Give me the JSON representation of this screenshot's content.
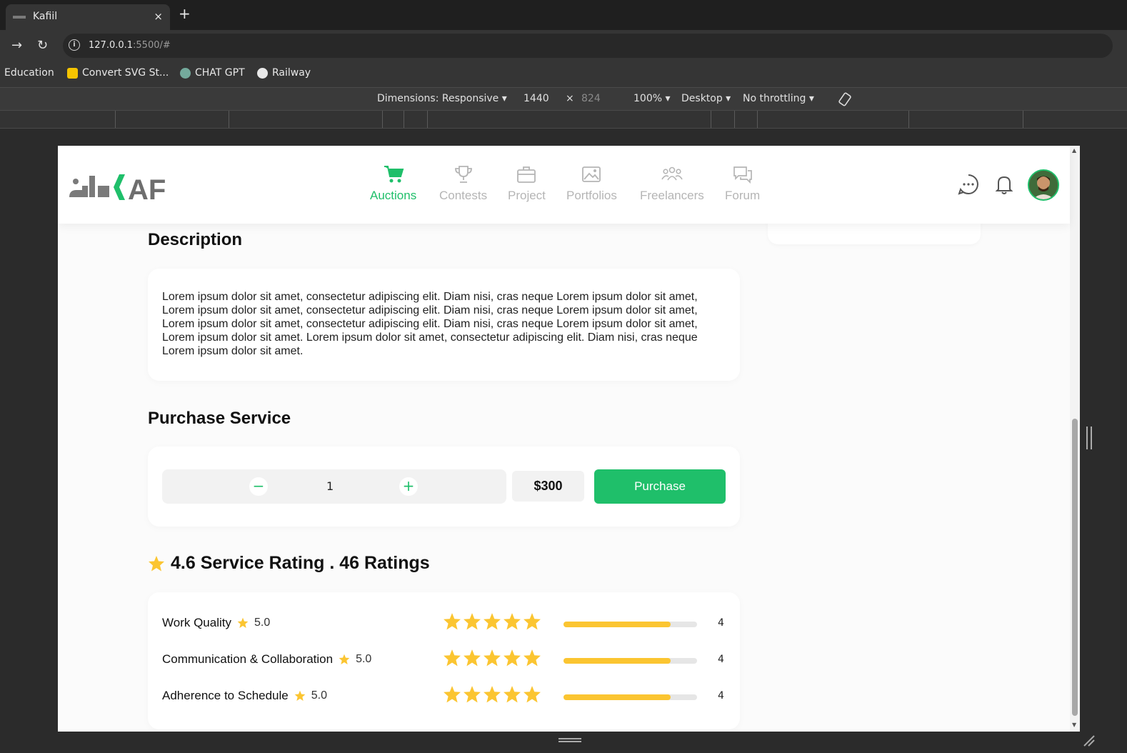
{
  "browser": {
    "tab_title": "Kafiil",
    "close_glyph": "×",
    "newtab_glyph": "+",
    "url_host": "127.0.0.1",
    "url_rest": ":5500/#",
    "bookmarks": [
      "Education",
      "Convert SVG St...",
      "CHAT GPT",
      "Railway"
    ]
  },
  "devtools": {
    "dimensions": "Dimensions: Responsive ▾",
    "width": "1440",
    "times": "×",
    "height": "824",
    "zoom": "100% ▾",
    "device": "Desktop ▾",
    "throttle": "No throttling ▾"
  },
  "nav": {
    "items": [
      {
        "label": "Auctions",
        "icon": "cart-icon"
      },
      {
        "label": "Contests",
        "icon": "trophy-icon"
      },
      {
        "label": "Project",
        "icon": "briefcase-icon"
      },
      {
        "label": "Portfolios",
        "icon": "image-icon"
      },
      {
        "label": "Freelancers",
        "icon": "users-icon"
      },
      {
        "label": "Forum",
        "icon": "forum-icon"
      }
    ],
    "active_color": "#1fbf6a",
    "inactive_color": "#b5b5b5"
  },
  "description": {
    "title": "Description",
    "text": "Lorem ipsum dolor sit amet, consectetur adipiscing elit. Diam nisi, cras neque Lorem ipsum dolor sit amet, Lorem ipsum dolor sit amet, consectetur adipiscing elit. Diam nisi, cras neque Lorem ipsum dolor sit amet, Lorem ipsum dolor sit amet, consectetur adipiscing elit. Diam nisi, cras neque Lorem ipsum dolor sit amet, Lorem ipsum dolor sit amet. Lorem ipsum dolor sit amet, consectetur adipiscing elit. Diam nisi, cras neque Lorem ipsum dolor sit amet."
  },
  "purchase": {
    "title": "Purchase Service",
    "minus": "−",
    "plus": "+",
    "quantity": "1",
    "price": "$300",
    "button": "Purchase"
  },
  "ratings": {
    "title": "4.6 Service Rating . 46 Ratings",
    "star_color": "#fbc531",
    "rows": [
      {
        "label": "Work Quality",
        "score": "5.0",
        "stars": 5,
        "count": "4",
        "fill": 0.8
      },
      {
        "label": "Communication & Collaboration",
        "score": "5.0",
        "stars": 5,
        "count": "4",
        "fill": 0.8
      },
      {
        "label": "Adherence to Schedule",
        "score": "5.0",
        "stars": 5,
        "count": "4",
        "fill": 0.8
      }
    ]
  }
}
